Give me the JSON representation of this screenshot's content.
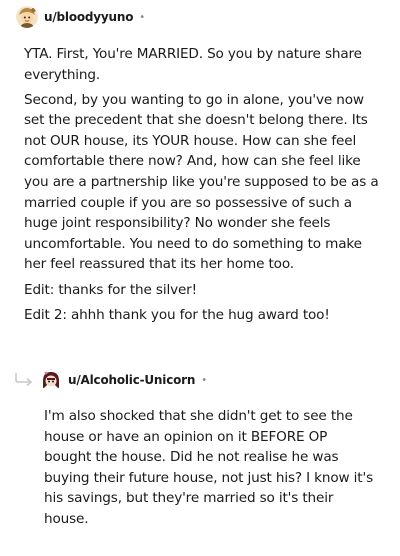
{
  "comments": [
    {
      "username": "u/bloodyyuno",
      "separator": "•",
      "paragraphs": [
        "YTA. First, You're MARRIED. So you by nature share everything.",
        "Second, by you wanting to go in alone, you've now set the precedent that she doesn't belong there. Its not OUR house, its YOUR house. How can she feel comfortable there now? And, how can she feel like you are a partnership like you're supposed to be as a married couple if you are so possessive of such a huge joint responsibility? No wonder she feels uncomfortable. You need to do something to make her feel reassured that its her home too.",
        "Edit: thanks for the silver!",
        "Edit 2: ahhh thank you for the hug award too!"
      ]
    },
    {
      "username": "u/Alcoholic-Unicorn",
      "separator": "•",
      "paragraphs": [
        "I'm also shocked that she didn't get to see the house or have an opinion on it BEFORE OP bought the house. Did he not realise he was buying their future house, not just his? I know it's his savings, but they're married so it's their house."
      ]
    }
  ],
  "icons": {
    "avatar_1": "avatar-icon",
    "avatar_2": "avatar-icon",
    "reply_indicator": "reply-arrow-icon"
  },
  "colors": {
    "text": "#1a1a1b",
    "meta": "#878a8c",
    "reply_arrow": "#c7c9cb"
  }
}
